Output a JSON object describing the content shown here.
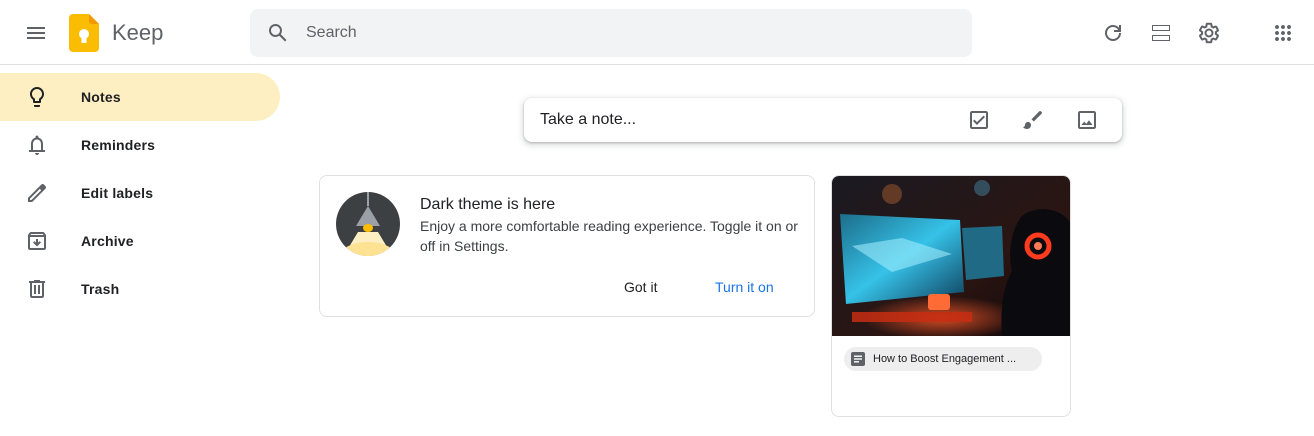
{
  "header": {
    "app_title": "Keep",
    "search": {
      "placeholder": "Search",
      "value": ""
    },
    "icons": [
      "menu-icon",
      "keep-logo",
      "search-icon",
      "refresh-icon",
      "list-view-icon",
      "settings-icon",
      "apps-grid-icon"
    ]
  },
  "sidebar": {
    "items": [
      {
        "label": "Notes",
        "icon": "lightbulb-icon",
        "active": true
      },
      {
        "label": "Reminders",
        "icon": "bell-icon",
        "active": false
      },
      {
        "label": "Edit labels",
        "icon": "pencil-icon",
        "active": false
      },
      {
        "label": "Archive",
        "icon": "archive-icon",
        "active": false
      },
      {
        "label": "Trash",
        "icon": "trash-icon",
        "active": false
      }
    ]
  },
  "take_note": {
    "placeholder": "Take a note...",
    "icons": [
      "checkbox-icon",
      "brush-icon",
      "image-icon"
    ]
  },
  "promo": {
    "title": "Dark theme is here",
    "body": "Enjoy a more comfortable reading experience. Toggle it on or off in Settings.",
    "dismiss_label": "Got it",
    "action_label": "Turn it on"
  },
  "notes": [
    {
      "image": "gamer-at-computer-image",
      "link_title": "How to Boost Engagement ...",
      "link_icon": "document-icon"
    }
  ],
  "colors": {
    "active_nav": "#feefc3",
    "accent_link": "#1a73e8",
    "search_bg": "#f1f3f4",
    "logo_yellow": "#fbbc04"
  }
}
